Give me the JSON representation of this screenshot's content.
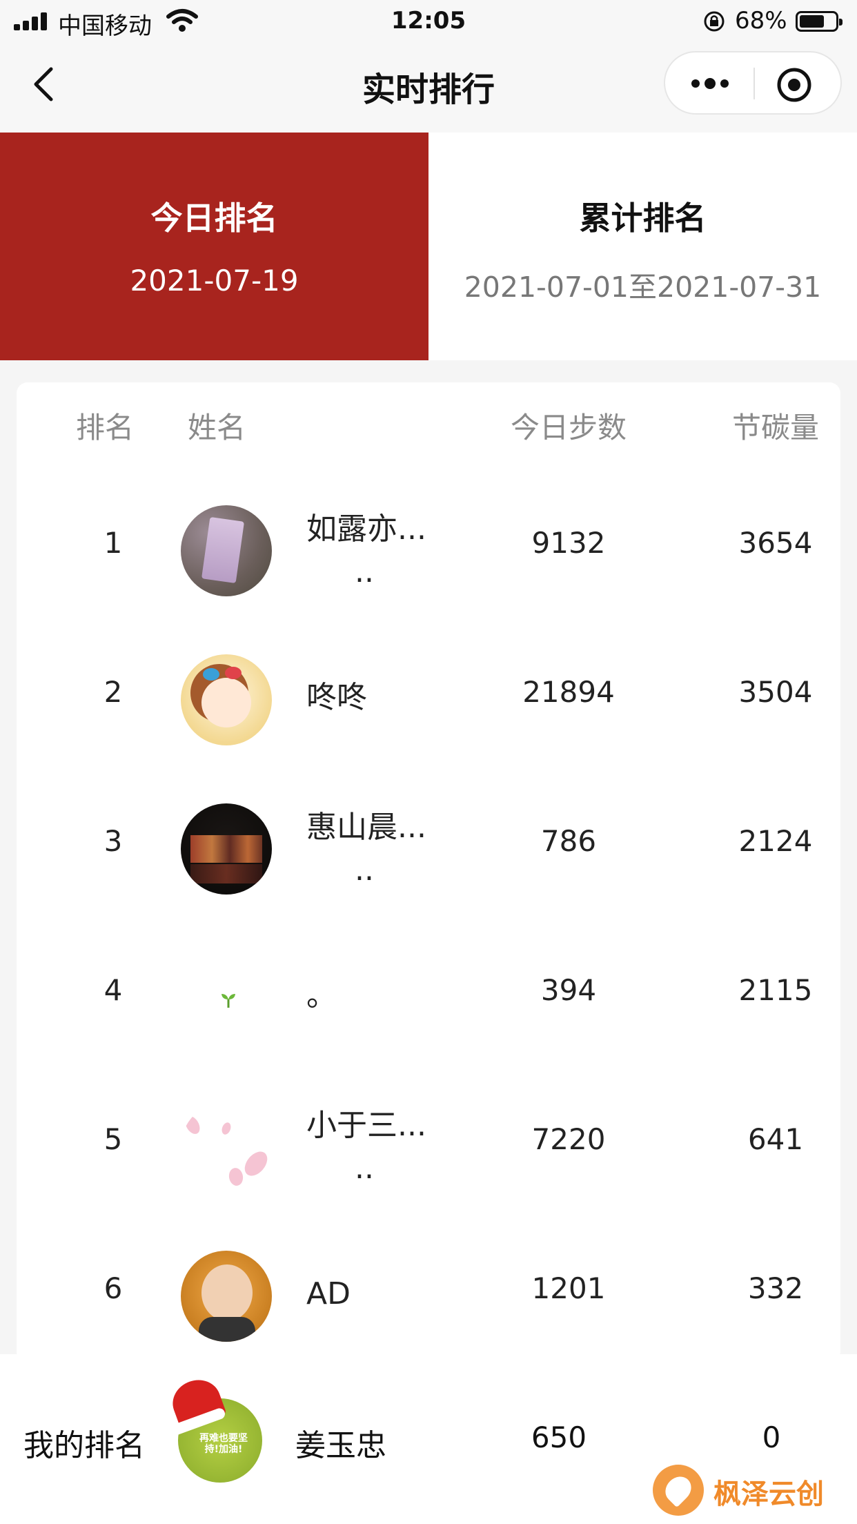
{
  "status_bar": {
    "carrier": "中国移动",
    "time": "12:05",
    "battery": "68%",
    "battery_level": 0.68
  },
  "nav": {
    "title": "实时排行"
  },
  "tabs": [
    {
      "label": "今日排名",
      "date": "2021-07-19",
      "active": true
    },
    {
      "label": "累计排名",
      "date": "2021-07-01至2021-07-31",
      "active": false
    }
  ],
  "table": {
    "headers": [
      "排名",
      "姓名",
      "今日步数",
      "节碳量"
    ],
    "rows": [
      {
        "rank": "1",
        "name_line1": "如露亦...",
        "name_line2": "..",
        "steps": "9132",
        "carbon": "3654"
      },
      {
        "rank": "2",
        "name_line1": "咚咚",
        "name_line2": "",
        "steps": "21894",
        "carbon": "3504"
      },
      {
        "rank": "3",
        "name_line1": "惠山晨...",
        "name_line2": "..",
        "steps": "786",
        "carbon": "2124"
      },
      {
        "rank": "4",
        "name_line1": "。",
        "name_line2": "",
        "steps": "394",
        "carbon": "2115"
      },
      {
        "rank": "5",
        "name_line1": "小于三...",
        "name_line2": "..",
        "steps": "7220",
        "carbon": "641"
      },
      {
        "rank": "6",
        "name_line1": "AD",
        "name_line2": "",
        "steps": "1201",
        "carbon": "332"
      }
    ]
  },
  "my_rank": {
    "label": "我的排名",
    "avatar_text": "再难也要坚持!加油!",
    "name": "姜玉忠",
    "steps": "650",
    "carbon": "0"
  },
  "watermark": {
    "text": "枫泽云创"
  },
  "colors": {
    "accent": "#a8241e",
    "watermark": "#f08a2a"
  }
}
